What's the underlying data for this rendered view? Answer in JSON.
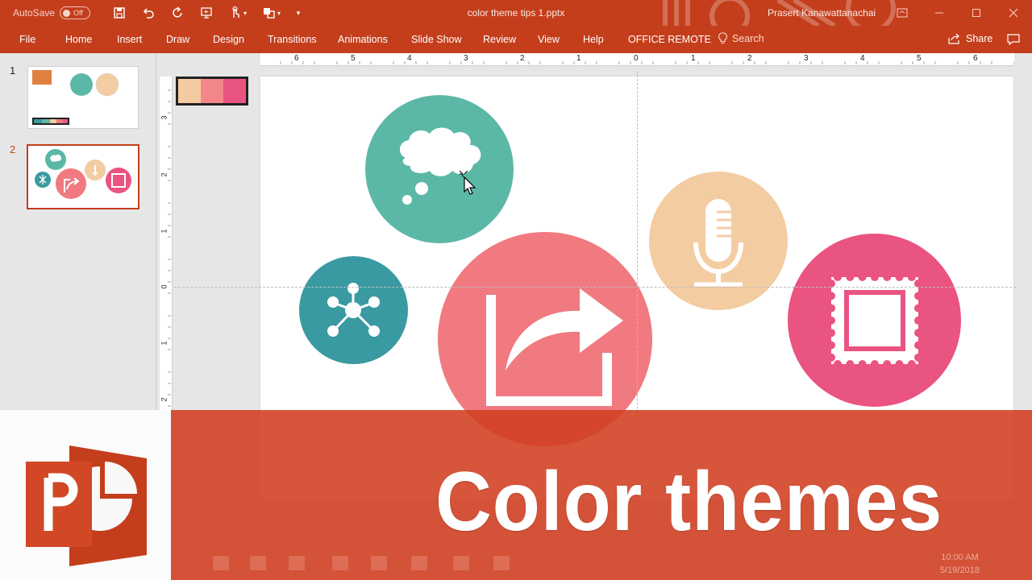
{
  "titlebar": {
    "autosave_label": "AutoSave",
    "autosave_state": "Off",
    "document_title": "color theme tips 1.pptx",
    "user_name": "Prasert Kanawattanachai"
  },
  "ribbon": {
    "tabs": [
      "File",
      "Home",
      "Insert",
      "Draw",
      "Design",
      "Transitions",
      "Animations",
      "Slide Show",
      "Review",
      "View",
      "Help",
      "OFFICE REMOTE"
    ],
    "search_label": "Search",
    "share_label": "Share"
  },
  "thumbnails": {
    "numbers": [
      "1",
      "2"
    ],
    "selected": 2
  },
  "rulers": {
    "horizontal": [
      "6",
      "5",
      "4",
      "3",
      "2",
      "1",
      "0",
      "1",
      "2",
      "3",
      "4",
      "5",
      "6"
    ],
    "vertical": [
      "3",
      "2",
      "1",
      "0",
      "1",
      "2"
    ]
  },
  "slide": {
    "palette": [
      "#f4cba0",
      "#f3868b",
      "#ea5480"
    ],
    "circles": [
      {
        "name": "thought-bubble",
        "color": "#5cb8a6"
      },
      {
        "name": "network",
        "color": "#3a9aa1"
      },
      {
        "name": "share-arrow",
        "color": "#f07a80"
      },
      {
        "name": "microphone",
        "color": "#f4cca2"
      },
      {
        "name": "stamp",
        "color": "#ea5480"
      }
    ]
  },
  "banner": {
    "title": "Color themes",
    "color": "#d03e20"
  },
  "taskbar": {
    "time": "10:00 AM",
    "date": "5/19/2018"
  },
  "colors": {
    "accent": "#c43e1c"
  }
}
